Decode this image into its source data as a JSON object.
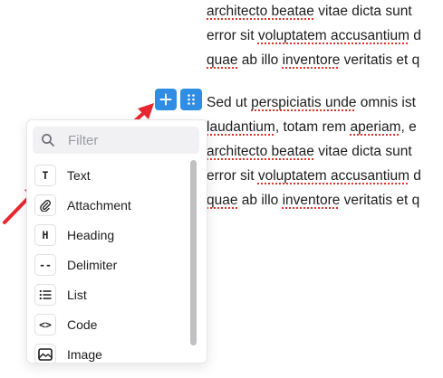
{
  "editor": {
    "paragraphs": [
      {
        "lines": [
          [
            {
              "t": "architecto beatae",
              "spell": true
            },
            {
              "t": " vitae dicta sunt",
              "spell": false
            }
          ],
          [
            {
              "t": "error sit ",
              "spell": false
            },
            {
              "t": "voluptatem accusantium",
              "spell": true
            },
            {
              "t": " d",
              "spell": false
            }
          ],
          [
            {
              "t": "quae",
              "spell": true
            },
            {
              "t": " ab illo ",
              "spell": false
            },
            {
              "t": "inventore",
              "spell": true
            },
            {
              "t": " veritatis et q",
              "spell": false
            }
          ]
        ]
      },
      {
        "lines": [
          [
            {
              "t": "Sed ut ",
              "spell": false
            },
            {
              "t": "perspiciatis unde",
              "spell": true
            },
            {
              "t": " omnis ist",
              "spell": false
            }
          ],
          [
            {
              "t": "laudantium",
              "spell": true
            },
            {
              "t": ", totam rem ",
              "spell": false
            },
            {
              "t": "aperiam",
              "spell": true
            },
            {
              "t": ", e",
              "spell": false
            }
          ],
          [
            {
              "t": "architecto beatae",
              "spell": true
            },
            {
              "t": " vitae dicta sunt",
              "spell": false
            }
          ],
          [
            {
              "t": "error sit ",
              "spell": false
            },
            {
              "t": "voluptatem accusantium",
              "spell": true
            },
            {
              "t": " d",
              "spell": false
            }
          ],
          [
            {
              "t": "quae",
              "spell": true
            },
            {
              "t": " ab illo ",
              "spell": false
            },
            {
              "t": "inventore",
              "spell": true
            },
            {
              "t": " veritatis et q",
              "spell": false
            }
          ]
        ]
      }
    ]
  },
  "toolbar": {
    "plus_icon": "plus-icon",
    "drag_icon": "drag-handle-icon",
    "button_color": "#2f8de4"
  },
  "popover": {
    "filter": {
      "placeholder": "Filter",
      "value": "",
      "icon": "search-icon"
    },
    "items": [
      {
        "label": "Text",
        "icon": "text-icon",
        "glyph": "T"
      },
      {
        "label": "Attachment",
        "icon": "paperclip-icon",
        "glyph": ""
      },
      {
        "label": "Heading",
        "icon": "heading-icon",
        "glyph": "H"
      },
      {
        "label": "Delimiter",
        "icon": "delimiter-icon",
        "glyph": "--"
      },
      {
        "label": "List",
        "icon": "list-icon",
        "glyph": ""
      },
      {
        "label": "Code",
        "icon": "code-icon",
        "glyph": "<>"
      },
      {
        "label": "Image",
        "icon": "image-icon",
        "glyph": ""
      }
    ]
  },
  "annotations": {
    "arrow_color": "#e8262f"
  }
}
